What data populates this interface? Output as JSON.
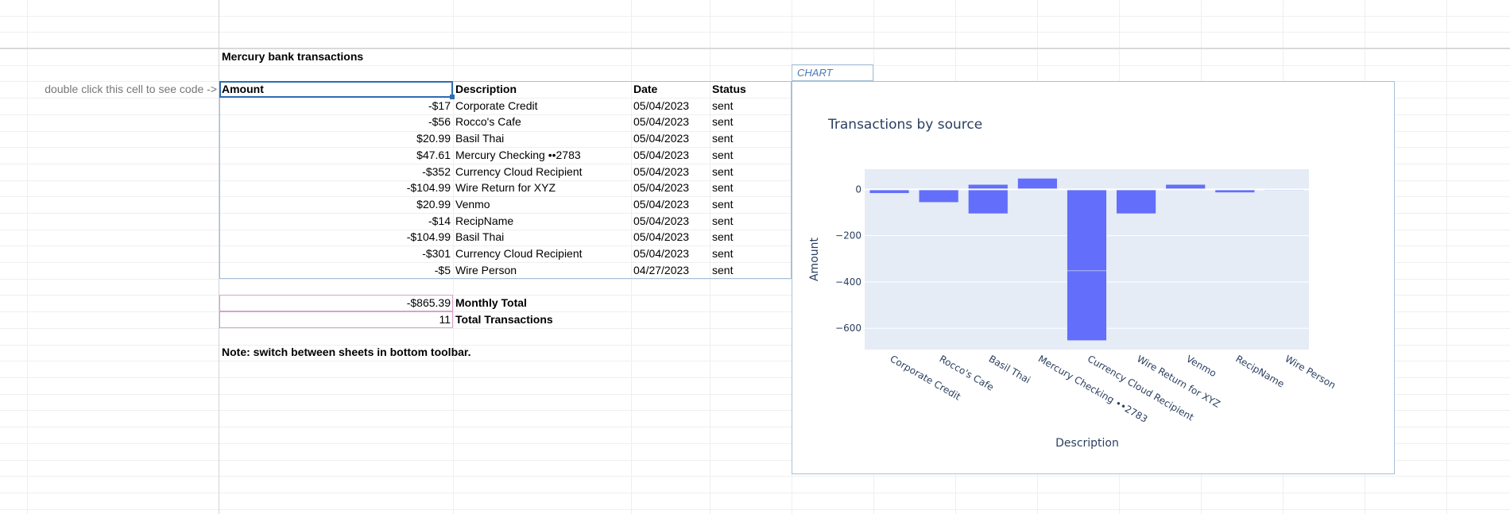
{
  "sheet": {
    "hint": "double click this cell to see code ->",
    "title": "Mercury bank transactions",
    "columns": [
      "Amount",
      "Description",
      "Date",
      "Status"
    ],
    "rows": [
      {
        "amount": "-$17",
        "description": "Corporate Credit",
        "date": "05/04/2023",
        "status": "sent"
      },
      {
        "amount": "-$56",
        "description": "Rocco's Cafe",
        "date": "05/04/2023",
        "status": "sent"
      },
      {
        "amount": "$20.99",
        "description": "Basil Thai",
        "date": "05/04/2023",
        "status": "sent"
      },
      {
        "amount": "$47.61",
        "description": "Mercury Checking ••2783",
        "date": "05/04/2023",
        "status": "sent"
      },
      {
        "amount": "-$352",
        "description": "Currency Cloud Recipient",
        "date": "05/04/2023",
        "status": "sent"
      },
      {
        "amount": "-$104.99",
        "description": "Wire Return for XYZ",
        "date": "05/04/2023",
        "status": "sent"
      },
      {
        "amount": "$20.99",
        "description": "Venmo",
        "date": "05/04/2023",
        "status": "sent"
      },
      {
        "amount": "-$14",
        "description": "RecipName",
        "date": "05/04/2023",
        "status": "sent"
      },
      {
        "amount": "-$104.99",
        "description": "Basil Thai",
        "date": "05/04/2023",
        "status": "sent"
      },
      {
        "amount": "-$301",
        "description": "Currency Cloud Recipient",
        "date": "05/04/2023",
        "status": "sent"
      },
      {
        "amount": "-$5",
        "description": "Wire Person",
        "date": "04/27/2023",
        "status": "sent"
      }
    ],
    "monthly_total_value": "-$865.39",
    "monthly_total_label": "Monthly Total",
    "total_transactions_value": "11",
    "total_transactions_label": "Total Transactions",
    "note": "Note: switch between sheets in bottom toolbar.",
    "chart_cell_label": "CHART"
  },
  "colors": {
    "bar": "#636efa",
    "plot_bg": "#e5ecf6",
    "text": "#2a3f5f",
    "selection": "#2e6db4"
  },
  "chart_data": {
    "type": "bar",
    "barmode": "relative (stacked)",
    "title": "Transactions by source",
    "xlabel": "Description",
    "ylabel": "Amount",
    "categories": [
      "Corporate Credit",
      "Rocco's Cafe",
      "Basil Thai",
      "Mercury Checking ••2783",
      "Currency Cloud Recipient",
      "Wire Return for XYZ",
      "Venmo",
      "RecipName",
      "Wire Person"
    ],
    "segments": [
      [
        -17
      ],
      [
        -56
      ],
      [
        20.99,
        -104.99
      ],
      [
        47.61
      ],
      [
        -352,
        -301
      ],
      [
        -104.99
      ],
      [
        20.99
      ],
      [
        -14
      ],
      [
        -5
      ]
    ],
    "yticks": [
      0,
      -200,
      -400,
      -600
    ],
    "ytick_labels": [
      "0",
      "−200",
      "−400",
      "−600"
    ],
    "ylim": [
      -692,
      87
    ],
    "grid": true,
    "legend": "none"
  }
}
